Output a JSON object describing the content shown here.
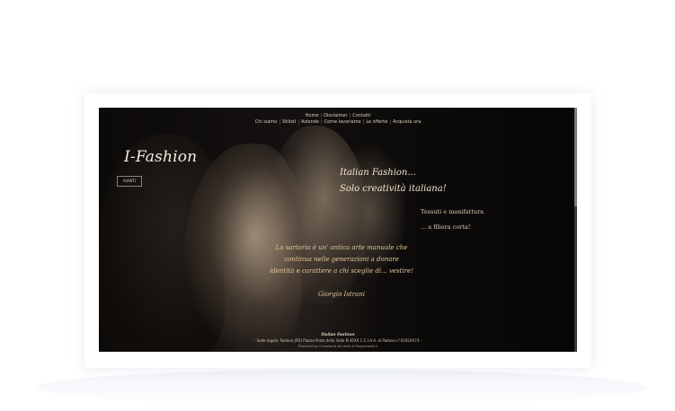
{
  "nav": {
    "row1": [
      "Home",
      "Disclaimer",
      "Contatti"
    ],
    "row2": [
      "Chi siamo",
      "Stilisti",
      "Aziende",
      "Come lavoriamo",
      "Le offerte",
      "Acquista ora"
    ]
  },
  "brand": {
    "logo": "I-Fashion",
    "avanti_label": "AVANTI"
  },
  "hero": {
    "headline_line1": "Italian Fashion...",
    "headline_line2": "Solo creatività italiana!",
    "sub_line1": "Tessuti e manifattura",
    "sub_line2": "... a filiera corta!"
  },
  "quote": {
    "line1": "La sartoria è un' antica arte manuale che",
    "line2": "continua nelle generazioni a donare",
    "line3": "identità e carattere a chi sceglie di... vestire!",
    "author": "Giorgio Istrani"
  },
  "footer": {
    "title": "Italian Fashion",
    "address": "- Sede legale: Padova (PD) Piazza Prato della Valle N 45XX C.C.I.A.A. di Padova n°4192XX74 -",
    "powered": "Powered by Creazione siti web di Pagineweb.it"
  }
}
